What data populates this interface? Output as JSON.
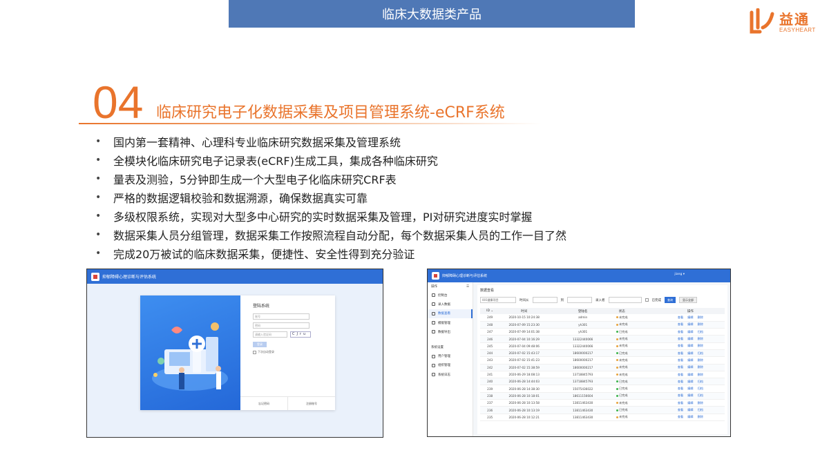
{
  "banner": {
    "title": "临床大数据类产品"
  },
  "logo": {
    "cn": "益通",
    "en": "EASYHEART"
  },
  "section": {
    "number": "04",
    "title": "临床研究电子化数据采集及项目管理系统-eCRF系统"
  },
  "bullets": [
    "国内第一套精神、心理科专业临床研究数据采集及管理系统",
    "全模块化临床研究电子记录表(eCRF)生成工具，集成各种临床研究",
    "量表及测验，5分钟即生成一个大型电子化临床研究CRF表",
    "严格的数据逻辑校验和数据溯源，确保数据真实可靠",
    "多级权限系统，实现对大型多中心研究的实时数据采集及管理，PI对研究进度实时掌握",
    "数据采集人员分组管理，数据采集工作按照流程自动分配，每个数据采集人员的工作一目了然",
    "完成20万被试的临床数据采集，便捷性、安全性得到充分验证"
  ],
  "bullet_symbol": "•",
  "login_screen": {
    "app_title": "抑郁障碍心理诊断与评估系统",
    "form_title": "登陆系统",
    "username_placeholder": "账号",
    "password_placeholder": "密码",
    "captcha_placeholder": "请输入验证码",
    "captcha_text": "CJru",
    "login_button": "登录",
    "remember_label": "下次自动登录",
    "forgot_link": "忘记密码",
    "register_link": "注册账号"
  },
  "data_screen": {
    "app_title": "抑郁障碍心理诊断与评估系统",
    "user": "jiang ▾",
    "side_head": "操作",
    "side_items": [
      "控制台",
      "录入数据",
      "数据查看",
      "模版管理",
      "数据导出"
    ],
    "side_active_index": 2,
    "side_group": "系统设置",
    "side_items2": [
      "用户管理",
      "组织管理",
      "系统日志"
    ],
    "panel_title": "数据查看",
    "filter": {
      "project": "001健康项目",
      "time_label": "时间从",
      "to_label": "到",
      "entrant_label": "录入者",
      "completed_label": "已完成",
      "query_button": "查询",
      "show_all_button": "显示全部"
    },
    "columns": [
      "ID ⌄",
      "时间",
      "",
      "登陆名",
      "状态",
      "",
      "操作"
    ],
    "actions": [
      "查看",
      "编辑",
      "删除"
    ],
    "status_colors": {
      "未完成": "#e8a33d",
      "已完成": "#3cb44b"
    },
    "rows": [
      [
        "249",
        "2020-10-15 10:24:38",
        "admin",
        "未完成",
        "删除"
      ],
      [
        "248",
        "2020-07-09 15:23:30",
        "yh301",
        "未完成",
        "删除"
      ],
      [
        "247",
        "2020-07-09 14:01:38",
        "yh301",
        "已完成",
        "归档"
      ],
      [
        "246",
        "2020-07-04 10:16:29",
        "13322440066",
        "未完成",
        "删除"
      ],
      [
        "245",
        "2020-07-04 09:48:06",
        "13322440066",
        "未完成",
        "删除"
      ],
      [
        "244",
        "2020-07-02 15:43:17",
        "18600000217",
        "已完成",
        "归档"
      ],
      [
        "243",
        "2020-07-02 15:41:23",
        "18600000217",
        "未完成",
        "删除"
      ],
      [
        "242",
        "2020-07-02 15:38:59",
        "18600000217",
        "未完成",
        "删除"
      ],
      [
        "241",
        "2020-06-29 18:08:13",
        "13718845793",
        "未完成",
        "删除"
      ],
      [
        "240",
        "2020-06-28 14:44:03",
        "13718845793",
        "已完成",
        "归档"
      ],
      [
        "239",
        "2020-06-28 14:38:30",
        "15075436022",
        "已完成",
        "归档"
      ],
      [
        "238",
        "2020-06-28 10:18:01",
        "18611156604",
        "已完成",
        "归档"
      ],
      [
        "237",
        "2020-06-28 10:13:58",
        "13811463430",
        "未完成",
        "删除"
      ],
      [
        "236",
        "2020-06-28 10:13:19",
        "13811463430",
        "已完成",
        "归档"
      ],
      [
        "235",
        "2020-06-28 10:12:21",
        "13811463430",
        "未完成",
        "删除"
      ]
    ]
  },
  "colors": {
    "accent_orange": "#e9742c",
    "banner_blue": "#4f78b6",
    "ui_blue": "#2f6fd6"
  }
}
